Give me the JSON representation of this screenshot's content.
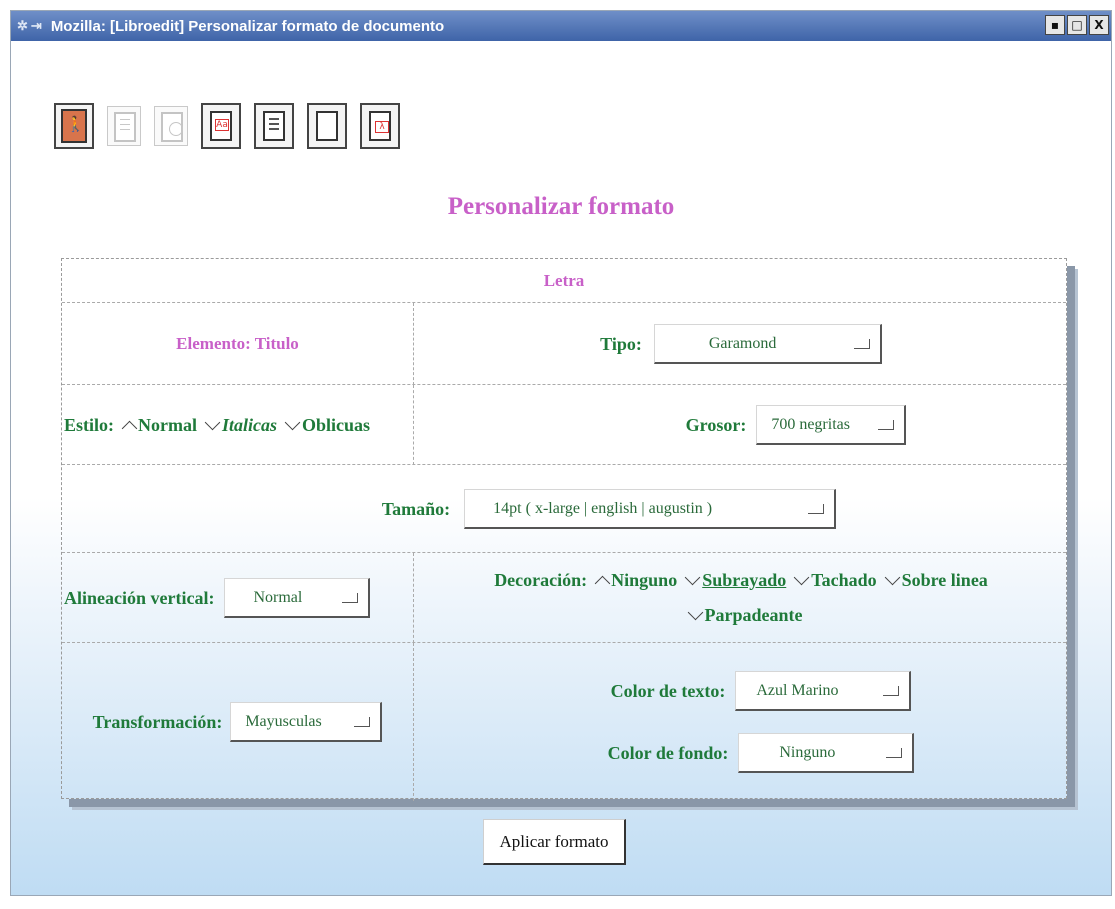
{
  "window": {
    "title": "Mozilla: [Libroedit] Personalizar formato de documento",
    "controls": [
      "▪",
      "□",
      "X"
    ]
  },
  "toolbar": {
    "buttons": [
      {
        "name": "exit",
        "enabled": true
      },
      {
        "name": "list",
        "enabled": false
      },
      {
        "name": "image",
        "enabled": false
      },
      {
        "name": "letter-format",
        "enabled": true
      },
      {
        "name": "text-format",
        "enabled": true
      },
      {
        "name": "page-format",
        "enabled": true
      },
      {
        "name": "symbol-format",
        "enabled": true
      }
    ]
  },
  "page_title": "Personalizar formato",
  "panel": {
    "header": "Letra",
    "element_label": "Elemento: Titulo",
    "tipo": {
      "label": "Tipo:",
      "value": "Garamond"
    },
    "estilo": {
      "label": "Estilo:",
      "options": [
        "Normal",
        "Italicas",
        "Oblicuas"
      ],
      "selected": "Normal"
    },
    "grosor": {
      "label": "Grosor:",
      "value": "700 negritas"
    },
    "tamano": {
      "label": "Tamaño:",
      "value": "14pt ( x-large | english | augustin )"
    },
    "alineacion": {
      "label": "Alineación vertical:",
      "value": "Normal"
    },
    "decoracion": {
      "label": "Decoración:",
      "options": [
        "Ninguno",
        "Subrayado",
        "Tachado",
        "Sobre linea",
        "Parpadeante"
      ],
      "selected": "Ninguno"
    },
    "transformacion": {
      "label": "Transformación:",
      "value": "Mayusculas"
    },
    "color_texto": {
      "label": "Color de texto:",
      "value": "Azul Marino"
    },
    "color_fondo": {
      "label": "Color de fondo:",
      "value": "Ninguno"
    }
  },
  "apply_button": "Aplicar formato",
  "colors": {
    "title_pink": "#c860c8",
    "label_green": "#1f7a3a",
    "titlebar_blue": "#3f64a8"
  }
}
